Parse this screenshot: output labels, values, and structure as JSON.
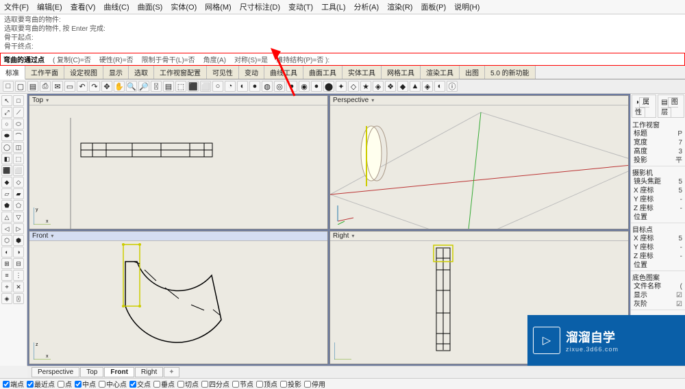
{
  "menubar": [
    "文件(F)",
    "编辑(E)",
    "查看(V)",
    "曲线(C)",
    "曲面(S)",
    "实体(O)",
    "网格(M)",
    "尺寸标注(D)",
    "变动(T)",
    "工具(L)",
    "分析(A)",
    "渲染(R)",
    "面板(P)",
    "说明(H)"
  ],
  "cmdlog": [
    "选取要弯曲的物件:",
    "选取要弯曲的物件, 按 Enter 完成:",
    "骨干起点:",
    "骨干终点:"
  ],
  "cmdprompt": {
    "label": "弯曲的通过点",
    "opts": [
      "( 复制(C)=否",
      "硬性(R)=否",
      "限制于骨干(L)=否",
      "角度(A)",
      "对称(S)=是",
      "维持结构(P)=否 ):"
    ]
  },
  "tabs": [
    "标准",
    "工作平面",
    "设定视图",
    "显示",
    "选取",
    "工作视窗配置",
    "可见性",
    "变动",
    "曲线工具",
    "曲面工具",
    "实体工具",
    "网格工具",
    "渲染工具",
    "出图",
    "5.0 的新功能"
  ],
  "tool_icons": [
    "□",
    "▢",
    "▤",
    "⎙",
    "✉",
    "▭",
    "↶",
    "↷",
    "✥",
    "✋",
    "🔍",
    "🔎",
    "〿",
    "▤",
    "⬚",
    "⬛",
    "⬜",
    "○",
    "◔",
    "◐",
    "●",
    "◍",
    "◎",
    "●",
    "◉",
    "●",
    "⬤",
    "✦",
    "◇",
    "★",
    "◈",
    "❖",
    "◆",
    "▲",
    "◈",
    "◐",
    "ⓘ"
  ],
  "left_icons": [
    "↖",
    "□",
    "⤢",
    "⟋",
    "○",
    "⬭",
    "⬬",
    "⌒",
    "◯",
    "◫",
    "◧",
    "⬚",
    "⬛",
    "⬜",
    "◆",
    "◇",
    "▱",
    "▰",
    "⬟",
    "⬠",
    "△",
    "▽",
    "◁",
    "▷",
    "⬡",
    "⬢",
    "◐",
    "◑",
    "⊞",
    "⊟",
    "≡",
    "⋮",
    "⌖",
    "✕",
    "◈",
    "〿"
  ],
  "viewports": {
    "top": {
      "title": "Top",
      "tri": "▾"
    },
    "persp": {
      "title": "Perspective",
      "tri": "▾"
    },
    "front": {
      "title": "Front",
      "tri": "▾"
    },
    "right": {
      "title": "Right",
      "tri": "▾"
    }
  },
  "bottom_tabs": [
    "Perspective",
    "Top",
    "Front",
    "Right"
  ],
  "bottom_active": "Front",
  "osnap": [
    {
      "label": "端点",
      "ck": true
    },
    {
      "label": "最近点",
      "ck": true
    },
    {
      "label": "点",
      "ck": false
    },
    {
      "label": "中点",
      "ck": true
    },
    {
      "label": "中心点",
      "ck": false
    },
    {
      "label": "交点",
      "ck": true
    },
    {
      "label": "垂点",
      "ck": false
    },
    {
      "label": "切点",
      "ck": false
    },
    {
      "label": "四分点",
      "ck": false
    },
    {
      "label": "节点",
      "ck": false
    },
    {
      "label": "顶点",
      "ck": false
    },
    {
      "label": "投影",
      "ck": false
    },
    {
      "label": "停用",
      "ck": false
    }
  ],
  "panel": {
    "tabs": [
      "属性",
      "图层"
    ],
    "sections": {
      "viewport": {
        "title": "工作视窗",
        "rows": [
          [
            "标题",
            "P"
          ],
          [
            "宽度",
            "7"
          ],
          [
            "高度",
            "3"
          ],
          [
            "投影",
            "平"
          ]
        ]
      },
      "camera": {
        "title": "摄影机",
        "rows": [
          [
            "镜头焦距",
            "5"
          ],
          [
            "X 座标",
            "5"
          ],
          [
            "Y 座标",
            "-"
          ],
          [
            "Z 座标",
            "-"
          ],
          [
            "位置",
            ""
          ]
        ]
      },
      "target": {
        "title": "目标点",
        "rows": [
          [
            "X 座标",
            "5"
          ],
          [
            "Y 座标",
            "-"
          ],
          [
            "Z 座标",
            "-"
          ],
          [
            "位置",
            ""
          ]
        ]
      },
      "wallpaper": {
        "title": "底色图案",
        "rows": [
          [
            "文件名称",
            "("
          ],
          [
            "显示",
            "☑"
          ],
          [
            "灰阶",
            "☑"
          ]
        ]
      }
    }
  },
  "watermark": {
    "cn": "溜溜自学",
    "en": "zixue.3d66.com"
  }
}
